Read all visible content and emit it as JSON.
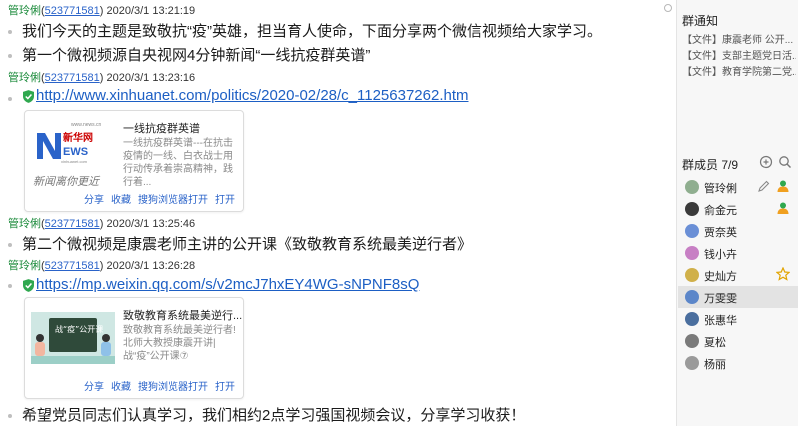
{
  "chat": {
    "messages": [
      {
        "sender": "管玲俐",
        "qq": "523771581",
        "time": "2020/3/1 13:21:19",
        "text": "我们今天的主题是致敬抗“疫”英雄，担当育人使命，下面分享两个微信视频给大家学习。"
      },
      {
        "text2": "第一个微视频源自央视网4分钟新闻“一线抗疫群英谱”"
      },
      {
        "sender": "管玲俐",
        "qq": "523771581",
        "time": "2020/3/1 13:23:16",
        "link": "http://www.xinhuanet.com/politics/2020-02/28/c_1125637262.htm"
      },
      {
        "sender": "管玲俐",
        "qq": "523771581",
        "time": "2020/3/1 13:25:46",
        "text": "第二个微视频是康震老师主讲的公开课《致敬教育系统最美逆行者》"
      },
      {
        "sender": "管玲俐",
        "qq": "523771581",
        "time": "2020/3/1 13:26:28",
        "link": "https://mp.weixin.qq.com/s/v2mcJ7hxEY4WG-sNPNF8sQ"
      },
      {
        "text": "希望党员同志们认真学习，我们相约2点学习强国视频会议，分享学习收获！"
      }
    ],
    "card1": {
      "logo_site": "www.news.cn",
      "logo_cn": "新华网",
      "logo_en": "EWS",
      "logo_domain": "xinhuanet.com",
      "slogan": "新闻离你更近",
      "title": "一线抗疫群英谱",
      "desc": "一线抗疫群英谱---在抗击疫情的一线、白衣战士用行动传承着崇高精神，践行着...",
      "actions": [
        "分享",
        "收藏",
        "搜狗浏览器打开",
        "打开"
      ]
    },
    "card2": {
      "thumb_text": "战“疫”公开课",
      "title": "致敬教育系统最美逆行...",
      "desc": "致敬教育系统最美逆行者! 北师大教授康震开讲| 战“疫”公开课⑦",
      "actions": [
        "分享",
        "收藏",
        "搜狗浏览器打开",
        "打开"
      ]
    }
  },
  "side": {
    "notice_title": "群通知",
    "notices": [
      "【文件】康震老师 公开...",
      "【文件】支部主题党日活...",
      "【文件】教育学院第二党..."
    ],
    "members_title": "群成员 7/9",
    "members": [
      {
        "name": "管玲俐",
        "color": "#8fae8f",
        "badge": "owner"
      },
      {
        "name": "俞金元",
        "color": "#3a3a3a",
        "badge": "admin"
      },
      {
        "name": "贾奈英",
        "color": "#6a8fd6",
        "badge": ""
      },
      {
        "name": "钱小卉",
        "color": "#c77fc4",
        "badge": ""
      },
      {
        "name": "史灿方",
        "color": "#d0b04a",
        "badge": "star"
      },
      {
        "name": "万雯雯",
        "color": "#5b86c9",
        "badge": ""
      },
      {
        "name": "张惠华",
        "color": "#4a6e9e",
        "badge": ""
      },
      {
        "name": "夏松",
        "color": "#7a7a7a",
        "badge": ""
      },
      {
        "name": "杨丽",
        "color": "#9a9a9a",
        "badge": ""
      }
    ]
  },
  "colors": {
    "link": "#1d5fc4",
    "sender": "#1a8a3a",
    "selected_row": "#e3e3e3"
  }
}
